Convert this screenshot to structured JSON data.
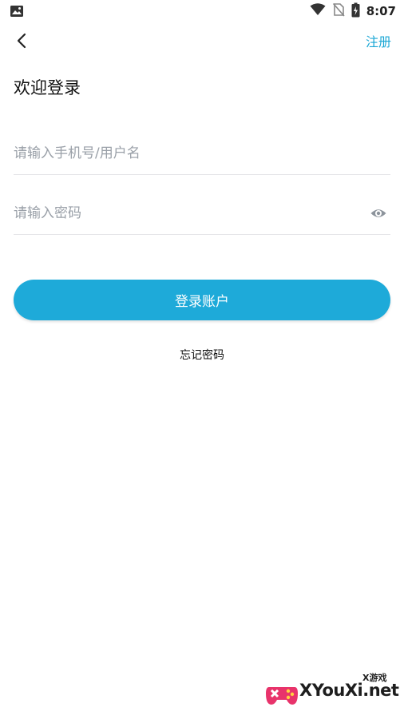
{
  "status_bar": {
    "time": "8:07",
    "icons": [
      "image-icon",
      "wifi-icon",
      "no-sim-icon",
      "battery-charging-icon"
    ]
  },
  "header": {
    "back_icon": "chevron-left-icon",
    "register_label": "注册"
  },
  "title": "欢迎登录",
  "form": {
    "username_placeholder": "请输入手机号/用户名",
    "username_value": "",
    "password_placeholder": "请输入密码",
    "password_value": "",
    "password_toggle_icon": "eye-icon",
    "login_button_label": "登录账户",
    "forgot_password_label": "忘记密码"
  },
  "watermark": {
    "main_text": "XYouXi.net",
    "sub_text": "X游戏"
  },
  "colors": {
    "accent": "#1eaad9",
    "link": "#1ba7d5",
    "placeholder": "#9aa0a8",
    "divider": "#e5e5e8"
  }
}
